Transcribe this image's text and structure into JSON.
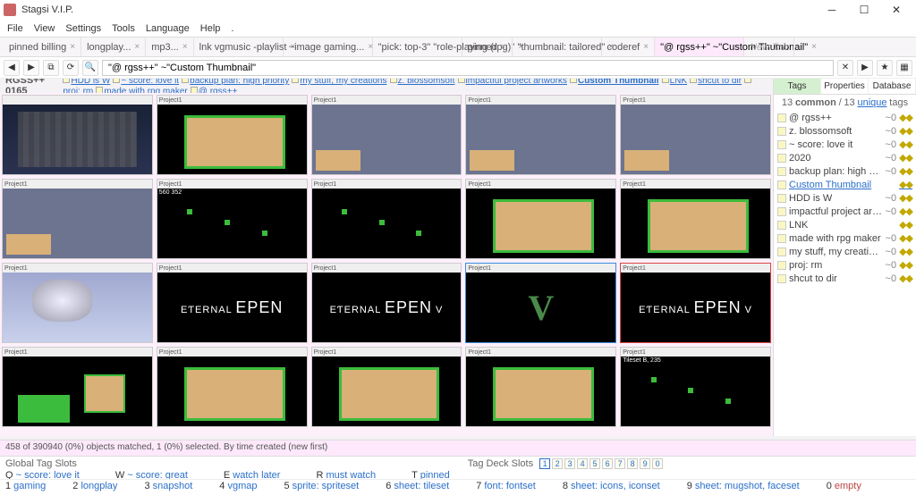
{
  "window": {
    "title": "Stagsi V.I.P."
  },
  "menu": [
    "File",
    "View",
    "Settings",
    "Tools",
    "Language",
    "Help",
    "."
  ],
  "tabs": [
    {
      "label": "pinned billing"
    },
    {
      "label": "longplay..."
    },
    {
      "label": "mp3..."
    },
    {
      "label": "lnk vgmusic -playlist"
    },
    {
      "label": "~image gaming..."
    },
    {
      "label": "\"pick: top-3\" \"role-playing (rpg)\""
    },
    {
      "label": "pinned"
    },
    {
      "label": "\"thumbnail: tailored\""
    },
    {
      "label": "coderef"
    },
    {
      "label": "\"@ rgss++\" ~\"Custom Thumbnail\"",
      "active": true
    },
    {
      "label": "New Tab",
      "new": true
    }
  ],
  "search": {
    "value": "\"@ rgss++\" ~\"Custom Thumbnail\""
  },
  "tagbar": {
    "title": "RGSS++ 0165",
    "chips": [
      "HDD is W",
      "~ score: love it",
      "backup plan: high priority",
      "my stuff, my creations",
      "z. blossomsoft",
      "impactful project artworks",
      "Custom Thumbnail",
      "LNK",
      "shcut to dir",
      "proj: rm",
      "made with rpg maker",
      "@ rgss++"
    ]
  },
  "thumbs": [
    {
      "title": "",
      "scene": "dungeon"
    },
    {
      "title": "Project1",
      "scene": "tileset"
    },
    {
      "title": "Project1",
      "scene": "cave"
    },
    {
      "title": "Project1",
      "scene": "cave"
    },
    {
      "title": "Project1",
      "scene": "cave"
    },
    {
      "title": "Project1",
      "scene": "cave"
    },
    {
      "title": "Project1",
      "scene": "black",
      "extra": "560 352"
    },
    {
      "title": "Project1",
      "scene": "black"
    },
    {
      "title": "Project1",
      "scene": "tileset"
    },
    {
      "title": "Project1",
      "scene": "tileset"
    },
    {
      "title": "Project1",
      "scene": "snow"
    },
    {
      "title": "Project1",
      "scene": "eden",
      "text": "EƬERNAL EPEN"
    },
    {
      "title": "Project1",
      "scene": "eden",
      "text": "EƬERNAL EPEN V"
    },
    {
      "title": "Project1",
      "scene": "v",
      "sel": "blue"
    },
    {
      "title": "Project1",
      "scene": "eden",
      "text": "EƬERNAL EPEN V",
      "sel": "red"
    },
    {
      "title": "Project1",
      "scene": "tilewide"
    },
    {
      "title": "Project1",
      "scene": "tileset"
    },
    {
      "title": "Project1",
      "scene": "tileset"
    },
    {
      "title": "Project1",
      "scene": "tileset"
    },
    {
      "title": "Project1",
      "scene": "black",
      "extra": "Tileset B, 235"
    }
  ],
  "status": "458 of 390940 (0%) objects matched, 1 (0%) selected. By time created (new first)",
  "global": {
    "header": "Global Tag Slots",
    "slots": [
      {
        "k": "Q",
        "t": "~ score: love it"
      },
      {
        "k": "W",
        "t": "~ score: great"
      },
      {
        "k": "E",
        "t": "watch later"
      },
      {
        "k": "R",
        "t": "must watch"
      },
      {
        "k": "T",
        "t": "pinned"
      }
    ]
  },
  "deck": {
    "header": "Tag Deck Slots",
    "nums": [
      "1",
      "2",
      "3",
      "4",
      "5",
      "6",
      "7",
      "8",
      "9",
      "0"
    ],
    "items": [
      {
        "n": "1",
        "t": "gaming"
      },
      {
        "n": "2",
        "t": "longplay"
      },
      {
        "n": "3",
        "t": "snapshot"
      },
      {
        "n": "4",
        "t": "vgmap"
      },
      {
        "n": "5",
        "t": "sprite: spriteset"
      },
      {
        "n": "6",
        "t": "sheet: tileset"
      },
      {
        "n": "7",
        "t": "font: fontset"
      },
      {
        "n": "8",
        "t": "sheet: icons, iconset"
      },
      {
        "n": "9",
        "t": "sheet: mugshot, faceset"
      },
      {
        "n": "0",
        "t": "empty",
        "e": true
      }
    ]
  },
  "panel": {
    "tabs": [
      "Tags",
      "Properties",
      "Database"
    ],
    "sub_common": "13",
    "sub_word_common": "common",
    "sub_sep": "/",
    "sub_unique": "13",
    "sub_word_unique": "unique",
    "sub_word_tags": "tags",
    "items": [
      {
        "name": "@ rgss++",
        "ct": "~0"
      },
      {
        "name": "z. blossomsoft",
        "ct": "~0"
      },
      {
        "name": "~ score: love it",
        "ct": "~0"
      },
      {
        "name": "2020",
        "ct": "~0"
      },
      {
        "name": "backup plan: high priority",
        "ct": "~0"
      },
      {
        "name": "Custom Thumbnail",
        "ct": "",
        "custom": true
      },
      {
        "name": "HDD is W",
        "ct": "~0"
      },
      {
        "name": "impactful project artworks",
        "ct": "~0"
      },
      {
        "name": "LNK",
        "ct": ""
      },
      {
        "name": "made with rpg maker",
        "ct": "~0"
      },
      {
        "name": "my stuff, my creations",
        "ct": "~0"
      },
      {
        "name": "proj: rm",
        "ct": "~0"
      },
      {
        "name": "shcut to dir",
        "ct": "~0"
      }
    ]
  }
}
